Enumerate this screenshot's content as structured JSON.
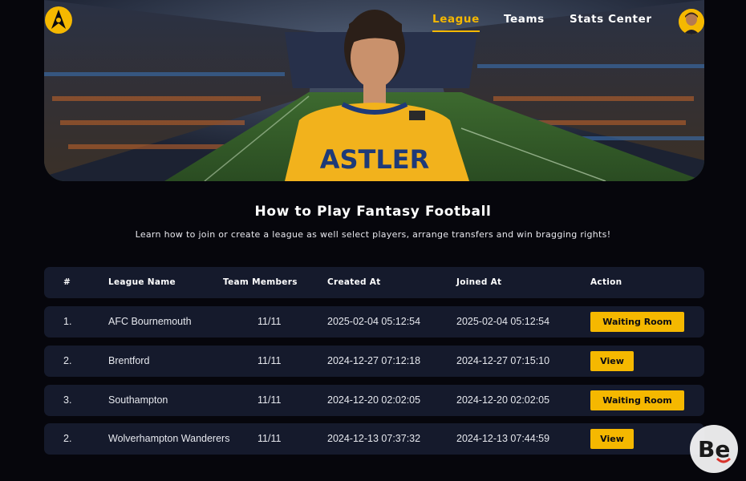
{
  "nav": {
    "items": [
      {
        "label": "League",
        "active": true
      },
      {
        "label": "Teams",
        "active": false
      },
      {
        "label": "Stats Center",
        "active": false
      }
    ]
  },
  "hero": {
    "jersey_text": "ASTLER",
    "jersey_color": "#f2b21c"
  },
  "intro": {
    "title": "How to Play Fantasy Football",
    "subtitle": "Learn how to join or create a league as well select players, arrange transfers and win bragging rights!"
  },
  "table": {
    "headers": {
      "num": "#",
      "league_name": "League Name",
      "team_members": "Team Members",
      "created_at": "Created  At",
      "joined_at": "Joined At",
      "action": "Action"
    },
    "rows": [
      {
        "num": "1.",
        "league_name": "AFC Bournemouth",
        "team_members": "11/11",
        "created_at": "2025-02-04 05:12:54",
        "joined_at": "2025-02-04 05:12:54",
        "action": "Waiting Room"
      },
      {
        "num": "2.",
        "league_name": "Brentford",
        "team_members": "11/11",
        "created_at": "2024-12-27 07:12:18",
        "joined_at": "2024-12-27 07:15:10",
        "action": "View"
      },
      {
        "num": "3.",
        "league_name": "Southampton",
        "team_members": "11/11",
        "created_at": "2024-12-20 02:02:05",
        "joined_at": "2024-12-20 02:02:05",
        "action": "Waiting Room"
      },
      {
        "num": "2.",
        "league_name": "Wolverhampton Wanderers",
        "team_members": "11/11",
        "created_at": "2024-12-13 07:37:32",
        "joined_at": "2024-12-13 07:44:59",
        "action": "View"
      }
    ]
  },
  "colors": {
    "accent": "#f5b800",
    "background": "#06060c",
    "row_background": "#151a2c"
  },
  "watermark": {
    "text": "Be"
  }
}
